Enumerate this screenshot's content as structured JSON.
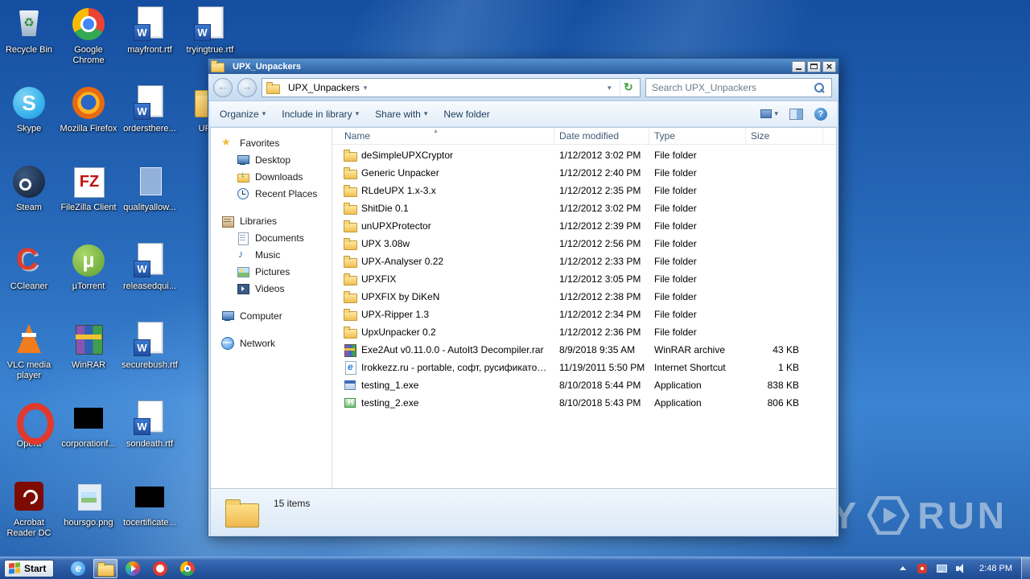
{
  "desktop": {
    "col1": [
      {
        "label": "Recycle Bin",
        "type": "t-recycle"
      },
      {
        "label": "Skype",
        "type": "t-skype"
      },
      {
        "label": "Steam",
        "type": "t-steam"
      },
      {
        "label": "CCleaner",
        "type": "t-ccleaner"
      },
      {
        "label": "VLC media player",
        "type": "t-vlc"
      },
      {
        "label": "Opera",
        "type": "t-opera"
      },
      {
        "label": "Acrobat Reader DC",
        "type": "t-acrobat"
      }
    ],
    "col2": [
      {
        "label": "Google Chrome",
        "type": "t-chrome"
      },
      {
        "label": "Mozilla Firefox",
        "type": "t-firefox"
      },
      {
        "label": "FileZilla Client",
        "type": "t-filezilla"
      },
      {
        "label": "µTorrent",
        "type": "t-utorrent"
      },
      {
        "label": "WinRAR",
        "type": "t-winrar"
      },
      {
        "label": "corporationf...",
        "type": "t-black"
      },
      {
        "label": "hoursgo.png",
        "type": "t-image"
      }
    ],
    "col3": [
      {
        "label": "mayfront.rtf",
        "type": "t-rtf"
      },
      {
        "label": "ordersthere...",
        "type": "t-rtf"
      },
      {
        "label": "qualityallow...",
        "type": "t-ghost"
      },
      {
        "label": "releasedqui...",
        "type": "t-rtf"
      },
      {
        "label": "securebush.rtf",
        "type": "t-rtf"
      },
      {
        "label": "sondeath.rtf",
        "type": "t-rtf"
      },
      {
        "label": "tocertificate...",
        "type": "t-black"
      }
    ],
    "col4": [
      {
        "label": "tryingtrue.rtf",
        "type": "t-rtf"
      },
      {
        "label": "UPX_",
        "type": "t-folder"
      }
    ]
  },
  "window": {
    "title": "UPX_Unpackers",
    "address": {
      "location": "UPX_Unpackers",
      "search": "Search UPX_Unpackers"
    },
    "toolbar": {
      "buttons": [
        {
          "label": "Organize",
          "caret": "▾"
        },
        {
          "label": "Include in library",
          "caret": "▾"
        },
        {
          "label": "Share with",
          "caret": "▾"
        },
        {
          "label": "New folder",
          "caret": ""
        }
      ]
    },
    "sidebar": {
      "items": [
        {
          "label": "Favorites",
          "icon": "ico-star",
          "cls": "lvl0"
        },
        {
          "label": "Desktop",
          "icon": "ico-desktop",
          "cls": "lvl1"
        },
        {
          "label": "Downloads",
          "icon": "ico-down",
          "cls": "lvl1"
        },
        {
          "label": "Recent Places",
          "icon": "ico-recent",
          "cls": "lvl1"
        },
        {
          "label": "Libraries",
          "icon": "ico-lib",
          "cls": "lvl0 gap"
        },
        {
          "label": "Documents",
          "icon": "ico-doc",
          "cls": "lvl1"
        },
        {
          "label": "Music",
          "icon": "ico-music",
          "cls": "lvl1"
        },
        {
          "label": "Pictures",
          "icon": "ico-pic",
          "cls": "lvl1"
        },
        {
          "label": "Videos",
          "icon": "ico-video",
          "cls": "lvl1"
        },
        {
          "label": "Computer",
          "icon": "ico-computer",
          "cls": "lvl0 gap"
        },
        {
          "label": "Network",
          "icon": "ico-network",
          "cls": "lvl0 gap"
        }
      ]
    },
    "columns": {
      "name": "Name",
      "modified": "Date modified",
      "type": "Type",
      "size": "Size"
    },
    "files": [
      {
        "name": "deSimpleUPXCryptor",
        "modified": "1/12/2012 3:02 PM",
        "type": "File folder",
        "size": "",
        "icon": "fico-folder"
      },
      {
        "name": "Generic Unpacker",
        "modified": "1/12/2012 2:40 PM",
        "type": "File folder",
        "size": "",
        "icon": "fico-folder"
      },
      {
        "name": "RLdeUPX 1.x-3.x",
        "modified": "1/12/2012 2:35 PM",
        "type": "File folder",
        "size": "",
        "icon": "fico-folder"
      },
      {
        "name": "ShitDie 0.1",
        "modified": "1/12/2012 3:02 PM",
        "type": "File folder",
        "size": "",
        "icon": "fico-folder"
      },
      {
        "name": "unUPXProtector",
        "modified": "1/12/2012 2:39 PM",
        "type": "File folder",
        "size": "",
        "icon": "fico-folder"
      },
      {
        "name": "UPX 3.08w",
        "modified": "1/12/2012 2:56 PM",
        "type": "File folder",
        "size": "",
        "icon": "fico-folder"
      },
      {
        "name": "UPX-Analyser 0.22",
        "modified": "1/12/2012 2:33 PM",
        "type": "File folder",
        "size": "",
        "icon": "fico-folder"
      },
      {
        "name": "UPXFIX",
        "modified": "1/12/2012 3:05 PM",
        "type": "File folder",
        "size": "",
        "icon": "fico-folder"
      },
      {
        "name": "UPXFIX by DiKeN",
        "modified": "1/12/2012 2:38 PM",
        "type": "File folder",
        "size": "",
        "icon": "fico-folder"
      },
      {
        "name": "UPX-Ripper 1.3",
        "modified": "1/12/2012 2:34 PM",
        "type": "File folder",
        "size": "",
        "icon": "fico-folder"
      },
      {
        "name": "UpxUnpacker 0.2",
        "modified": "1/12/2012 2:36 PM",
        "type": "File folder",
        "size": "",
        "icon": "fico-folder"
      },
      {
        "name": "Exe2Aut v0.11.0.0 - AutoIt3 Decompiler.rar",
        "modified": "8/9/2018 9:35 AM",
        "type": "WinRAR archive",
        "size": "43 KB",
        "icon": "fico-rar"
      },
      {
        "name": "Irokkezz.ru - portable, софт, русификатор...",
        "modified": "11/19/2011 5:50 PM",
        "type": "Internet Shortcut",
        "size": "1 KB",
        "icon": "fico-url"
      },
      {
        "name": "testing_1.exe",
        "modified": "8/10/2018 5:44 PM",
        "type": "Application",
        "size": "838 KB",
        "icon": "fico-app"
      },
      {
        "name": "testing_2.exe",
        "modified": "8/10/2018 5:43 PM",
        "type": "Application",
        "size": "806 KB",
        "icon": "fico-app2"
      }
    ],
    "status": "15 items"
  },
  "taskbar": {
    "start_label": "Start",
    "clock": "2:48 PM"
  },
  "watermark": {
    "left": "ANY",
    "right": "RUN"
  }
}
